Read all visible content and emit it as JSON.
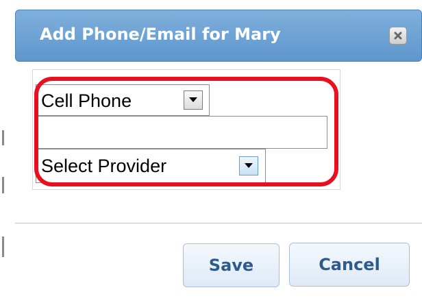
{
  "dialog": {
    "title": "Add Phone/Email for Mary",
    "close_icon": "close-icon"
  },
  "form": {
    "phone_type": {
      "selected": "Cell Phone",
      "icon": "dropdown-arrow-icon"
    },
    "contact_input": {
      "value": "",
      "placeholder": ""
    },
    "provider": {
      "selected": "Select Provider",
      "icon": "dropdown-arrow-icon"
    }
  },
  "buttons": {
    "save_label": "Save",
    "cancel_label": "Cancel"
  },
  "colors": {
    "titlebar": "#6aa0d3",
    "highlight": "#e8101e",
    "button_text": "#2d5b8b"
  }
}
